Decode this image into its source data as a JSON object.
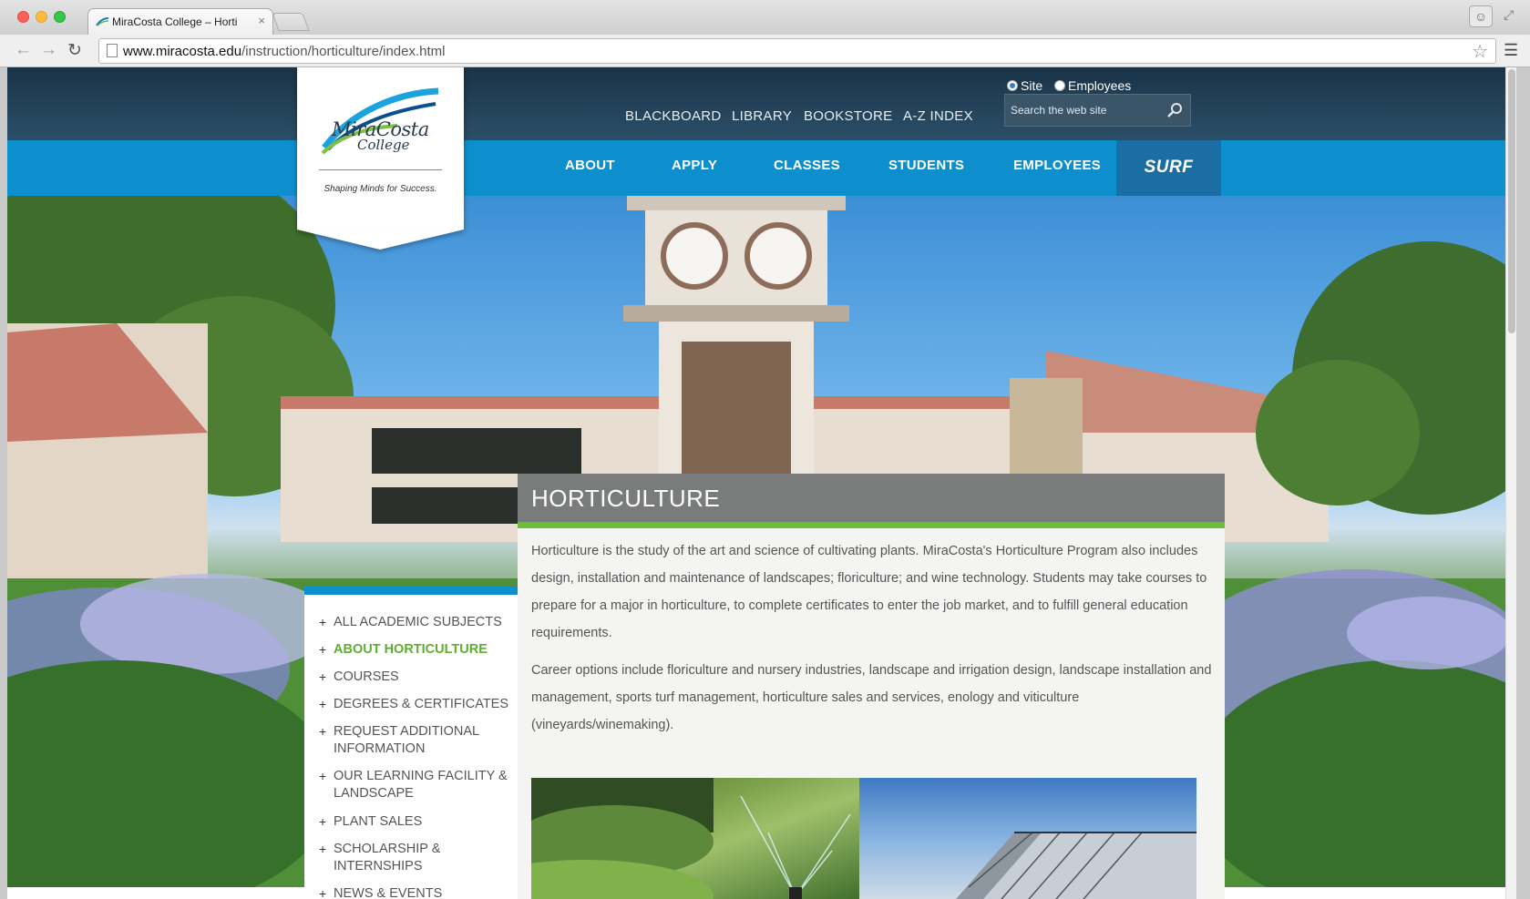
{
  "browser": {
    "tab_title": "MiraCosta College – Horti",
    "tab_close": "×",
    "url_host": "www.miracosta.edu",
    "url_path": "/instruction/horticulture/index.html",
    "icons": [
      "back-arrow-icon",
      "forward-arrow-icon",
      "reload-icon",
      "page-icon",
      "star-icon",
      "menu-icon",
      "profile-icon",
      "expand-icon"
    ]
  },
  "header": {
    "logo_line1": "MiraCosta",
    "logo_line2": "College",
    "logo_tagline": "Shaping Minds for Success.",
    "utility_links": [
      "BLACKBOARD",
      "LIBRARY",
      "BOOKSTORE",
      "A-Z INDEX"
    ],
    "search_scope": {
      "options": [
        "Site",
        "Employees"
      ],
      "selected": "Site"
    },
    "search_placeholder": "Search the web site",
    "nav": [
      "ABOUT",
      "APPLY",
      "CLASSES",
      "STUDENTS",
      "EMPLOYEES"
    ],
    "surf": "SURF"
  },
  "sidebar": {
    "items": [
      {
        "label": "All Academic Subjects",
        "active": false
      },
      {
        "label": "About Horticulture",
        "active": true
      },
      {
        "label": "Courses",
        "active": false
      },
      {
        "label": "Degrees & Certificates",
        "active": false
      },
      {
        "label": "Request Additional Information",
        "active": false
      },
      {
        "label": "Our Learning Facility & Landscape",
        "active": false
      },
      {
        "label": "Plant Sales",
        "active": false
      },
      {
        "label": "Scholarship & Internships",
        "active": false
      },
      {
        "label": "News & Events",
        "active": false
      }
    ]
  },
  "content": {
    "title": "HORTICULTURE",
    "paragraph1": "Horticulture is the study of the art and science of cultivating plants. MiraCosta's Horticulture Program also includes design, installation and maintenance of landscapes; floriculture; and wine technology. Students may take courses to prepare for a major in horticulture, to complete certificates to enter the job market, and to fulfill general education requirements.",
    "paragraph2": "Career options include floriculture and nursery industries, landscape and irrigation design, landscape installation and management, sports turf management, horticulture sales and services, enology and viticulture (vineyards/winemaking)."
  },
  "colors": {
    "nav_blue": "#0d8fcd",
    "header_dark": "#1a3347",
    "accent_green": "#6bbd3a",
    "active_link": "#5fae2e",
    "surf_blue": "#1b6ea4"
  }
}
